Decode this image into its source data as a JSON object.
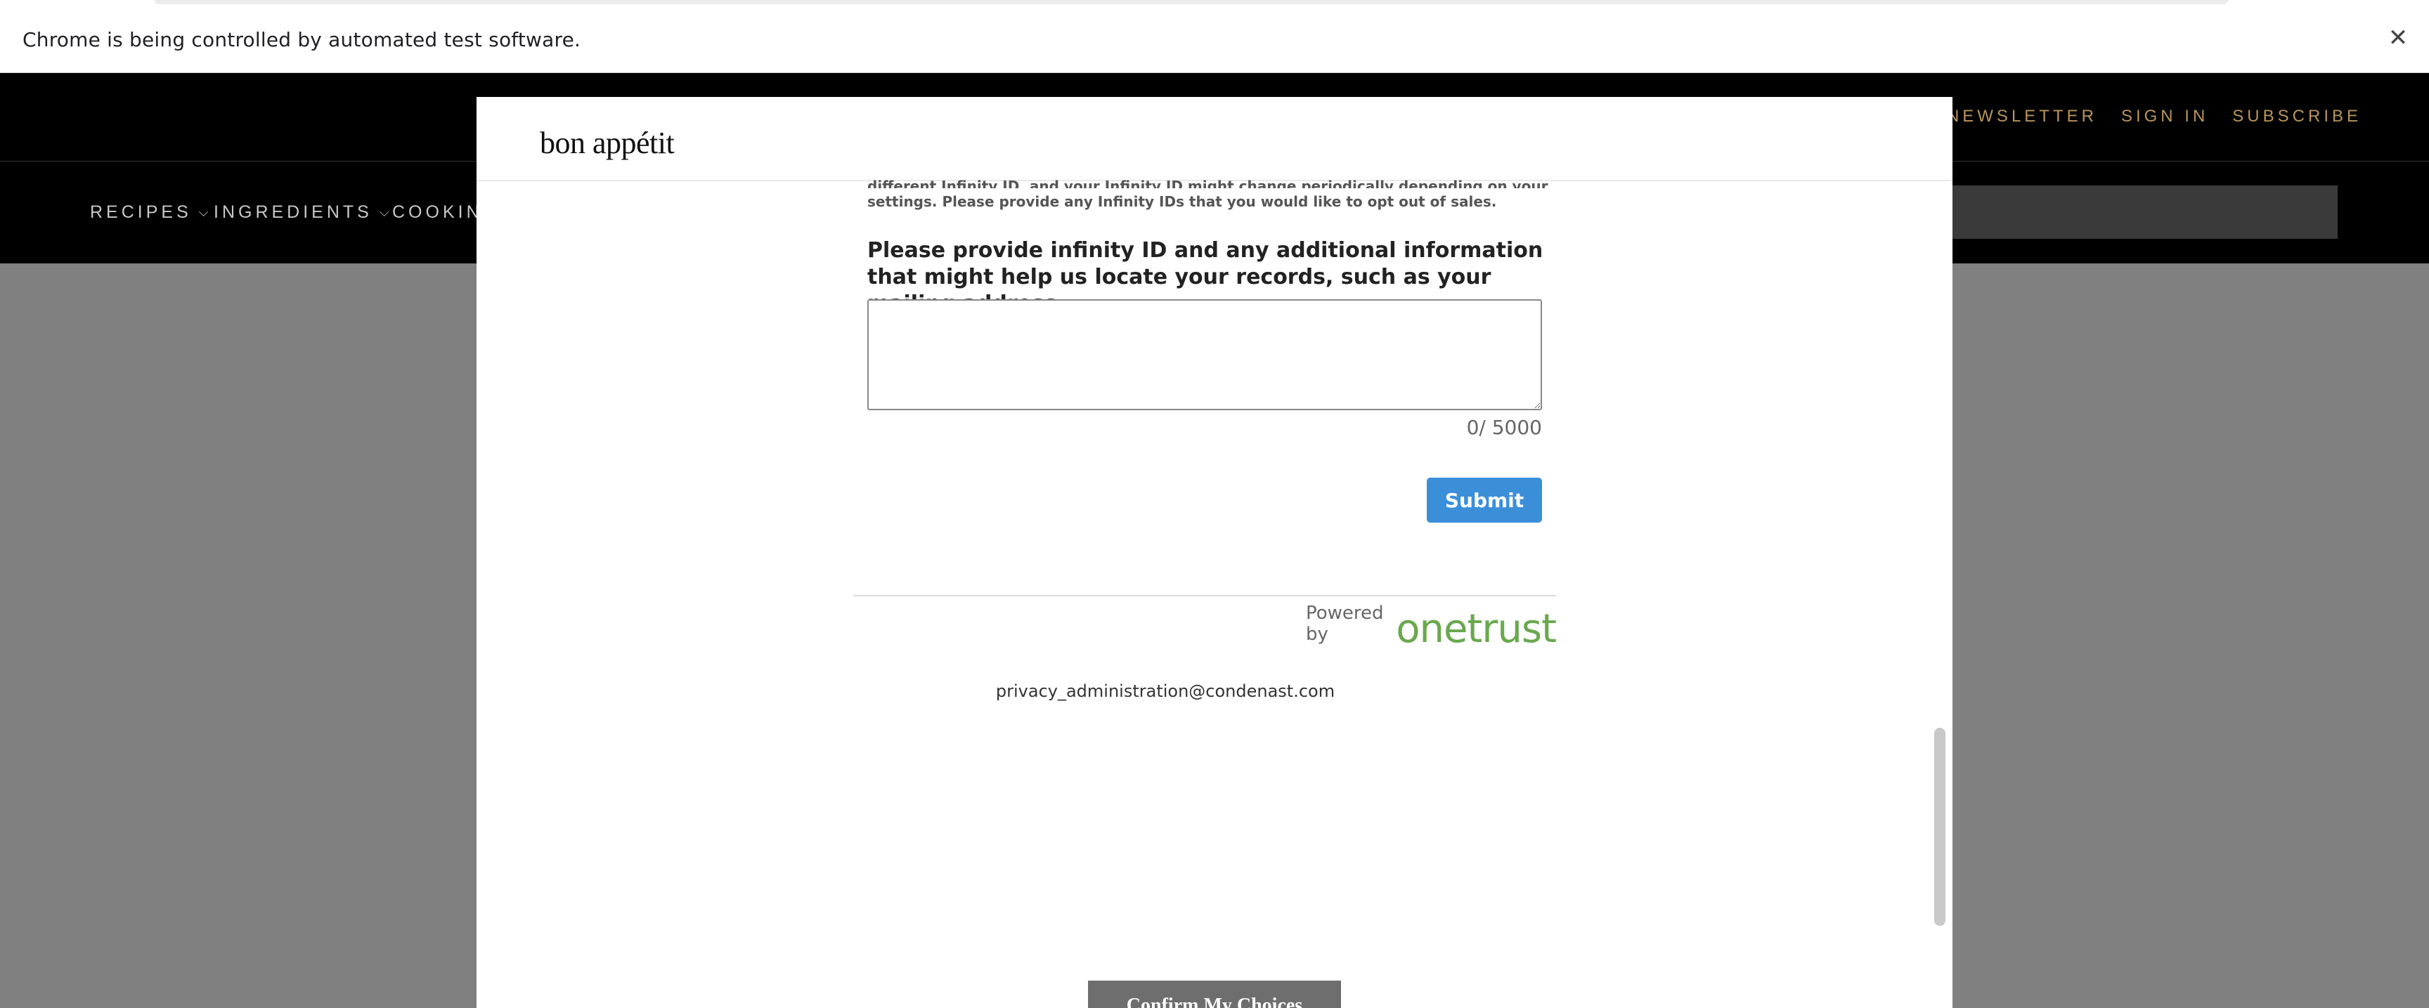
{
  "browser": {
    "infobar_message": "Chrome is being controlled by automated test software.",
    "close_glyph": "✕"
  },
  "site": {
    "top_links": [
      "NEWSLETTER",
      "SIGN IN",
      "SUBSCRIBE"
    ],
    "nav_items": [
      "RECIPES",
      "INGREDIENTS",
      "COOKIN"
    ],
    "accent_color": "#b7955c"
  },
  "modal": {
    "logo": "bon appétit",
    "partial_text_line1": "different Infinity ID, and your Infinity ID might change periodically depending on your",
    "partial_text_line2": "settings. Please provide any Infinity IDs that you would like to opt out of sales.",
    "question": "Please provide infinity ID and any additional information that might help us locate your records, such as your mailing address.",
    "textarea_value": "",
    "counter": "0/ 5000",
    "submit_label": "Submit",
    "powered_by": "Powered by",
    "powered_brand": "onetrust",
    "contact_email": "privacy_administration@condenast.com",
    "confirm_label": "Confirm My Choices",
    "submit_color": "#3b8fd9",
    "brand_color": "#6aa84f"
  }
}
